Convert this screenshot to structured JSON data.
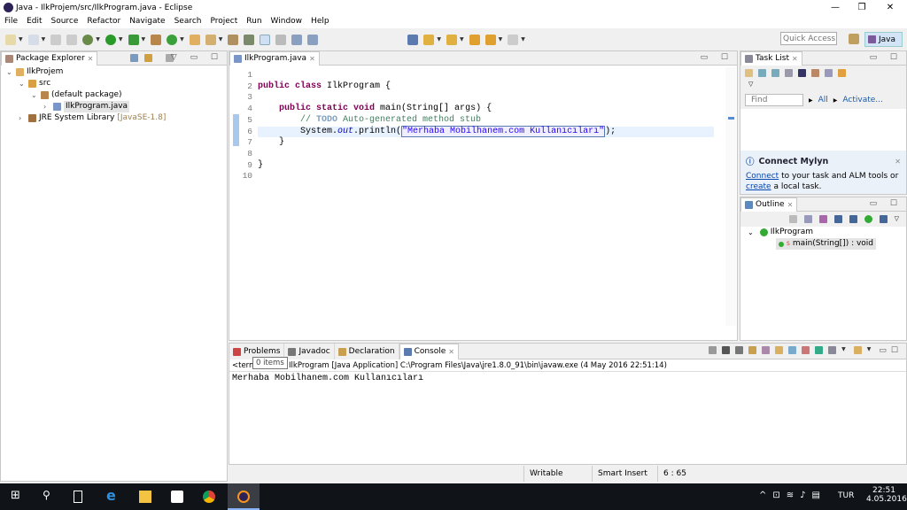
{
  "window": {
    "title": "Java - IlkProjem/src/IlkProgram.java - Eclipse",
    "minimize": "—",
    "maximize": "❐",
    "close": "✕"
  },
  "menu": [
    "File",
    "Edit",
    "Source",
    "Refactor",
    "Navigate",
    "Search",
    "Project",
    "Run",
    "Window",
    "Help"
  ],
  "toolbar": {
    "quick_access_placeholder": "Quick Access",
    "perspective": "Java"
  },
  "package_explorer": {
    "title": "Package Explorer",
    "tree": [
      {
        "label": "IlkProjem",
        "level": 0,
        "expanded": true,
        "icon": "project-icon"
      },
      {
        "label": "src",
        "level": 1,
        "expanded": true,
        "icon": "source-folder-icon"
      },
      {
        "label": "(default package)",
        "level": 2,
        "expanded": true,
        "icon": "package-icon"
      },
      {
        "label": "IlkProgram.java",
        "level": 3,
        "expanded": false,
        "selected": true,
        "icon": "java-file-icon"
      },
      {
        "label": "JRE System Library",
        "suffix": "[JavaSE-1.8]",
        "level": 1,
        "expanded": false,
        "icon": "library-icon"
      }
    ]
  },
  "editor": {
    "tab": "IlkProgram.java",
    "lines": [
      [],
      [
        {
          "t": "public class ",
          "c": "kw"
        },
        {
          "t": "IlkProgram {",
          "c": ""
        }
      ],
      [],
      [
        {
          "t": "    "
        },
        {
          "t": "public static void ",
          "c": "kw"
        },
        {
          "t": "main(String[] args) {",
          "c": ""
        }
      ],
      [
        {
          "t": "        // ",
          "c": "cm"
        },
        {
          "t": "TODO",
          "c": "todo"
        },
        {
          "t": " Auto-generated method stub",
          "c": "cm"
        }
      ],
      [
        {
          "t": "        System."
        },
        {
          "t": "out",
          "c": "fld"
        },
        {
          "t": ".println("
        },
        {
          "t": "\"Merhaba Mobilhanem.com Kullanıcıları\"",
          "c": "str"
        },
        {
          "t": ");"
        }
      ],
      [
        {
          "t": "    }"
        }
      ],
      [],
      [
        {
          "t": "}"
        }
      ],
      []
    ],
    "current_line": 6
  },
  "task_list": {
    "title": "Task List",
    "find_placeholder": "Find",
    "all": "All",
    "activate": "Activate...",
    "mylyn_title": "Connect Mylyn",
    "mylyn_connect": "Connect",
    "mylyn_text1": " to your task and ALM tools or",
    "mylyn_create": "create",
    "mylyn_text2": " a local task."
  },
  "outline": {
    "title": "Outline",
    "class": "IlkProgram",
    "method": "main(String[]) : void"
  },
  "bottom": {
    "tabs": [
      "Problems",
      "Javadoc",
      "Declaration",
      "Console"
    ],
    "active": "Console",
    "tooltip": "0 items",
    "launch_info": "<terminated> IlkProgram [Java Application] C:\\Program Files\\Java\\jre1.8.0_91\\bin\\javaw.exe (4 May 2016 22:51:14)",
    "output": "Merhaba Mobilhanem.com Kullanıcıları"
  },
  "status": {
    "writable": "Writable",
    "insert": "Smart Insert",
    "position": "6 : 65"
  },
  "taskbar": {
    "lang": "TUR",
    "time": "22:51",
    "date": "4.05.2016"
  }
}
